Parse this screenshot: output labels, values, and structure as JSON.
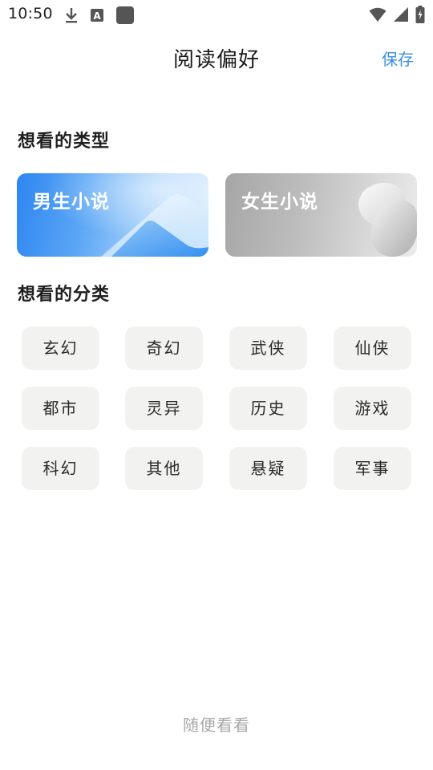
{
  "status_bar": {
    "time": "10:50",
    "left_icons": [
      "download-icon",
      "text-a-icon",
      "square-app-icon"
    ],
    "right_icons": [
      "wifi-icon",
      "signal-icon",
      "battery-charging-icon"
    ]
  },
  "header": {
    "title": "阅读偏好",
    "save_label": "保存",
    "accent_color": "#3a8ee6"
  },
  "type_section": {
    "title": "想看的类型",
    "cards": [
      {
        "label": "男生小说",
        "theme": "blue"
      },
      {
        "label": "女生小说",
        "theme": "gray"
      }
    ]
  },
  "category_section": {
    "title": "想看的分类",
    "chips": [
      {
        "label": "玄幻"
      },
      {
        "label": "奇幻"
      },
      {
        "label": "武侠"
      },
      {
        "label": "仙侠"
      },
      {
        "label": "都市"
      },
      {
        "label": "灵异"
      },
      {
        "label": "历史"
      },
      {
        "label": "游戏"
      },
      {
        "label": "科幻"
      },
      {
        "label": "其他"
      },
      {
        "label": "悬疑"
      },
      {
        "label": "军事"
      }
    ]
  },
  "footer": {
    "skip_label": "随便看看"
  }
}
